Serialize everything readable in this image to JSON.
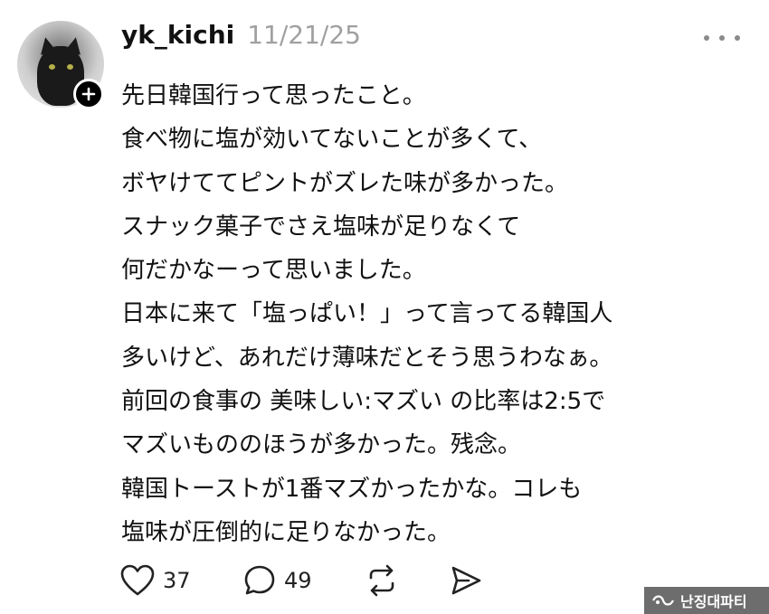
{
  "post": {
    "username": "yk_kichi",
    "date": "11/21/25",
    "lines": [
      "先日韓国行って思ったこと。",
      "食べ物に塩が効いてないことが多くて、",
      "ボヤけててピントがズレた味が多かった。",
      "スナック菓子でさえ塩味が足りなくて",
      "何だかなーって思いました。",
      "日本に来て「塩っぱい！」って言ってる韓国人",
      "多いけど、あれだけ薄味だとそう思うわなぁ。",
      "前回の食事の 美味しい:マズい の比率は2:5で",
      "マズいもののほうが多かった。残念。",
      "韓国トーストが1番マズかったかな。コレも",
      "塩味が圧倒的に足りなかった。"
    ]
  },
  "actions": {
    "likes": "37",
    "replies": "49"
  },
  "icons": {
    "follow": "plus-icon",
    "more": "more-dots-icon",
    "like": "heart-icon",
    "reply": "comment-bubble-icon",
    "repost": "repost-icon",
    "share": "send-icon"
  },
  "watermark": {
    "text": "난징대파티"
  }
}
